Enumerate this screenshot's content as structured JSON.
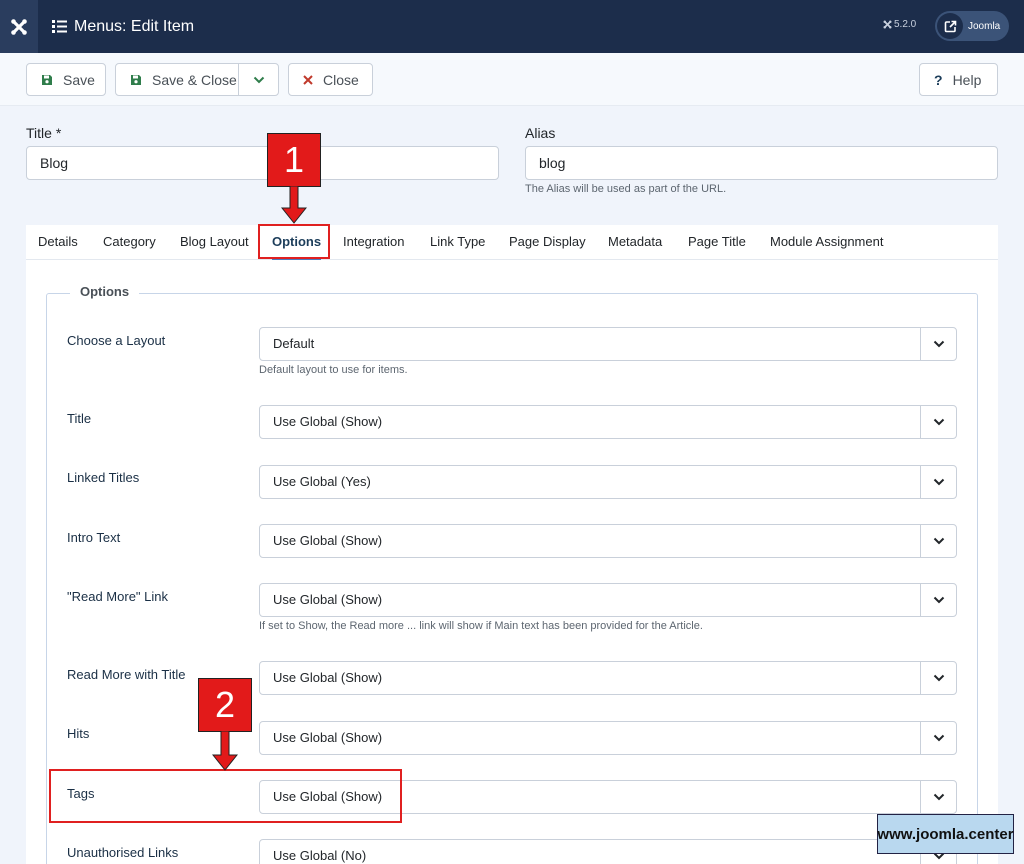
{
  "header": {
    "title": "Menus: Edit Item",
    "version": "5.2.0",
    "site_link_label": "Joomla"
  },
  "toolbar": {
    "save_label": "Save",
    "save_close_label": "Save & Close",
    "close_label": "Close",
    "help_label": "Help"
  },
  "form": {
    "title_label": "Title *",
    "title_value": "Blog",
    "alias_label": "Alias",
    "alias_value": "blog",
    "alias_hint": "The Alias will be used as part of the URL."
  },
  "tabs": [
    {
      "label": "Details"
    },
    {
      "label": "Category"
    },
    {
      "label": "Blog Layout"
    },
    {
      "label": "Options"
    },
    {
      "label": "Integration"
    },
    {
      "label": "Link Type"
    },
    {
      "label": "Page Display"
    },
    {
      "label": "Metadata"
    },
    {
      "label": "Page Title"
    },
    {
      "label": "Module Assignment"
    }
  ],
  "active_tab": "Options",
  "options": {
    "legend": "Options",
    "fields": [
      {
        "label": "Choose a Layout",
        "value": "Default",
        "hint": "Default layout to use for items."
      },
      {
        "label": "Title",
        "value": "Use Global (Show)"
      },
      {
        "label": "Linked Titles",
        "value": "Use Global (Yes)"
      },
      {
        "label": "Intro Text",
        "value": "Use Global (Show)"
      },
      {
        "label": "\"Read More\" Link",
        "value": "Use Global (Show)",
        "hint": "If set to Show, the Read more ... link will show if Main text has been provided for the Article."
      },
      {
        "label": "Read More with Title",
        "value": "Use Global (Show)"
      },
      {
        "label": "Hits",
        "value": "Use Global (Show)"
      },
      {
        "label": "Tags",
        "value": "Use Global (Show)"
      },
      {
        "label": "Unauthorised Links",
        "value": "Use Global (No)"
      }
    ]
  },
  "annotations": {
    "step1": "1",
    "step2": "2",
    "highlight_color": "#e02020"
  },
  "watermark": "www.joomla.center",
  "colors": {
    "header_bg": "#1c2d4b",
    "accent": "#4a7cc0",
    "save_icon": "#2f7d4b",
    "close_icon": "#c0392b"
  }
}
